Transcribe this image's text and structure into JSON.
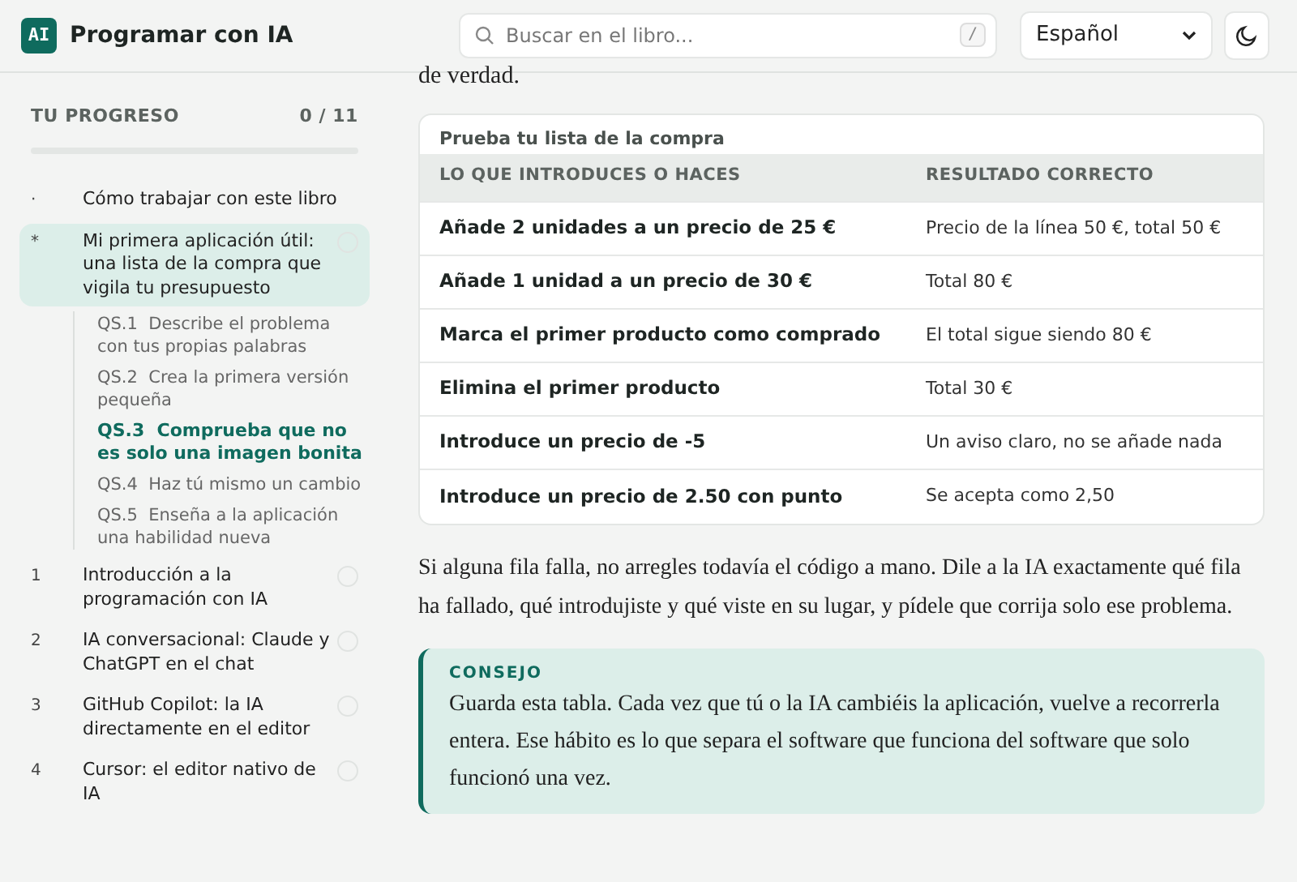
{
  "header": {
    "logo": "AI",
    "title": "Programar con IA",
    "search": {
      "placeholder": "Buscar en el libro...",
      "shortcut": "/"
    },
    "language": "Español"
  },
  "sidebar": {
    "progress": {
      "label": "TU PROGRESO",
      "count": "0 / 11",
      "level": 0
    },
    "items": [
      {
        "marker": "·",
        "title": "Cómo trabajar con este libro",
        "selected": false
      },
      {
        "marker": "*",
        "title": "Mi primera aplicación útil: una lista de la compra que vigila tu presupuesto",
        "selected": true,
        "completed": false,
        "children": [
          {
            "code": "QS.1",
            "title": "Describe el problema con tus propias palabras",
            "selected": false
          },
          {
            "code": "QS.2",
            "title": "Crea la primera versión pequeña",
            "selected": false
          },
          {
            "code": "QS.3",
            "title": "Comprueba que no es solo una imagen bonita",
            "selected": true
          },
          {
            "code": "QS.4",
            "title": "Haz tú mismo un cambio",
            "selected": false
          },
          {
            "code": "QS.5",
            "title": "Enseña a la aplicación una habilidad nueva",
            "selected": false
          }
        ]
      },
      {
        "marker": "1",
        "title": "Introducción a la programación con IA",
        "selected": false,
        "completed": false
      },
      {
        "marker": "2",
        "title": "IA conversacional: Claude y ChatGPT en el chat",
        "selected": false,
        "completed": false
      },
      {
        "marker": "3",
        "title": "GitHub Copilot: la IA directamente en el editor",
        "selected": false,
        "completed": false
      },
      {
        "marker": "4",
        "title": "Cursor: el editor nativo de IA",
        "selected": false,
        "completed": false
      }
    ]
  },
  "content": {
    "lead_end": "de verdad.",
    "table": {
      "caption": "Prueba tu lista de la compra",
      "columns": [
        "LO QUE INTRODUCES O HACES",
        "RESULTADO CORRECTO"
      ],
      "rows": [
        [
          "Añade 2 unidades a un precio de 25 €",
          "Precio de la línea 50 €, total 50 €"
        ],
        [
          "Añade 1 unidad a un precio de 30 €",
          "Total 80 €"
        ],
        [
          "Marca el primer producto como comprado",
          "El total sigue siendo 80 €"
        ],
        [
          "Elimina el primer producto",
          "Total 30 €"
        ],
        [
          "Introduce un precio de -5",
          "Un aviso claro, no se añade nada"
        ],
        [
          "Introduce un precio de 2.50 con punto",
          "Se acepta como 2,50"
        ]
      ]
    },
    "paragraph": "Si alguna fila falla, no arregles todavía el código a mano. Dile a la IA exactamente qué fila ha fallado, qué introdujiste y qué viste en su lugar, y pídele que corrija solo ese problema.",
    "tip": {
      "label": "CONSEJO",
      "text": "Guarda esta tabla. Cada vez que tú o la IA cambiéis la aplicación, vuelve a recorrerla entera. Ese hábito es lo que separa el software que funciona del software que solo funcionó una vez."
    }
  }
}
